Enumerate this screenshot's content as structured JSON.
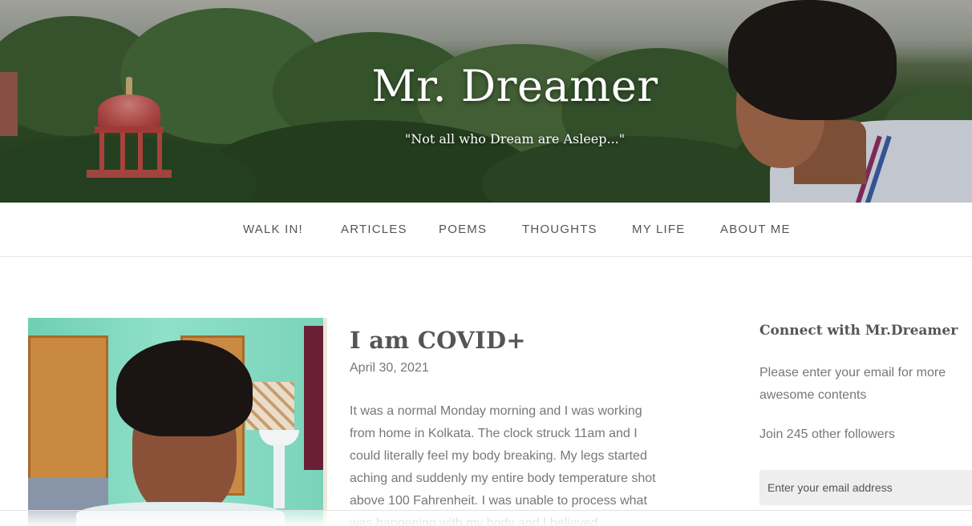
{
  "header": {
    "site_title": "Mr. Dreamer",
    "tagline": "\"Not all who Dream are Asleep...\""
  },
  "nav": {
    "items": [
      "WALK IN!",
      "ARTICLES",
      "POEMS",
      "THOUGHTS",
      "MY LIFE",
      "ABOUT ME"
    ]
  },
  "post": {
    "title": "I am COVID+",
    "date": "April 30, 2021",
    "excerpt": "It was a normal Monday morning and I was working from home in Kolkata. The clock struck 11am and I could literally feel my body breaking. My legs started aching and suddenly my entire body temperature shot above 100 Fahrenheit. I was unable to process what was happening with my body and I believed"
  },
  "sidebar": {
    "widget_title": "Connect with Mr.Dreamer",
    "description": "Please enter your email for more awesome contents",
    "followers": "Join 245 other followers",
    "email_placeholder": "Enter your email address"
  }
}
